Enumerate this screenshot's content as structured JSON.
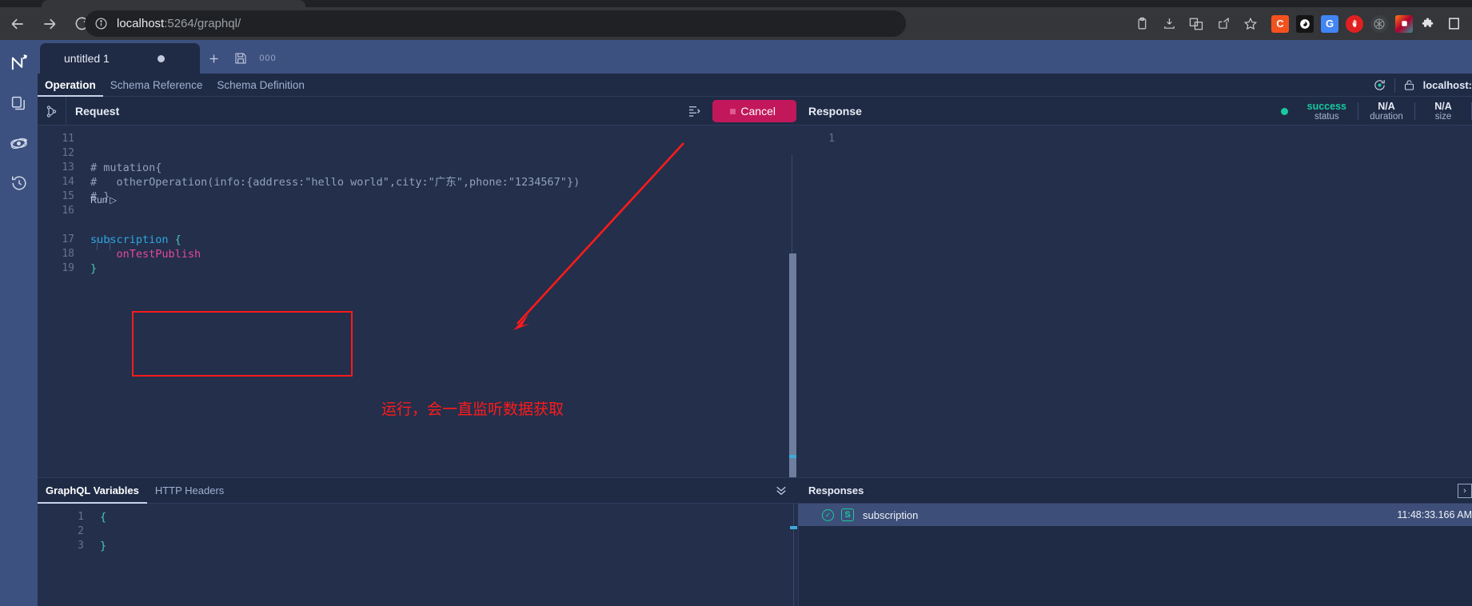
{
  "browser": {
    "nav": {
      "back": "back-arrow",
      "forward": "forward-arrow",
      "reload": "reload"
    },
    "url_host": "localhost",
    "url_rest": ":5264/graphql/",
    "omnibox_actions": [
      "clipboard-icon",
      "install-app-icon",
      "translate-icon",
      "share-icon",
      "bookmark-star-icon"
    ],
    "extensions": [
      {
        "name": "C",
        "color": "#f4511e"
      },
      {
        "name": "",
        "color": "#1b1b1b"
      },
      {
        "name": "G",
        "color": "#4285f4"
      },
      {
        "name": "",
        "color": "#e02020"
      },
      {
        "name": "",
        "color": "#5f6368"
      },
      {
        "name": "",
        "color": "#c2185b"
      },
      {
        "name": "",
        "color": "#5f6368"
      },
      {
        "name": "",
        "color": "#ffffff"
      }
    ]
  },
  "rail": {
    "items": [
      {
        "name": "app-logo",
        "label": "Altair"
      },
      {
        "name": "copy-documents-icon",
        "label": "Documents"
      },
      {
        "name": "atom-icon",
        "label": "Environments"
      },
      {
        "name": "history-clock-icon",
        "label": "History"
      }
    ]
  },
  "tabbar": {
    "document_tab": "untitled 1",
    "unsaved_dot": true,
    "add_label": "+",
    "save_label": "save-icon",
    "more_label": "000"
  },
  "section_tabs": [
    {
      "label": "Operation",
      "active": true
    },
    {
      "label": "Schema Reference",
      "active": false
    },
    {
      "label": "Schema Definition",
      "active": false
    }
  ],
  "section_right": {
    "reload_docs_icon": "refresh-docs-icon",
    "lock_icon": "unlocked-padlock-icon",
    "endpoint": "localhost:"
  },
  "request": {
    "panel_title": "Request",
    "gutter_icon": "history-branch-icon",
    "prettify_icon": "prettify-icon",
    "cancel_label": "Cancel",
    "run_lens": "Run ▷",
    "code_lines": [
      {
        "no": "11",
        "segments": []
      },
      {
        "no": "12",
        "segments": []
      },
      {
        "no": "13",
        "segments": [
          {
            "t": "# mutation{",
            "c": "c-comment"
          }
        ]
      },
      {
        "no": "14",
        "segments": [
          {
            "t": "#   otherOperation(info:{address:\"hello world\",city:\"广东\",phone:\"1234567\"})",
            "c": "c-comment"
          }
        ]
      },
      {
        "no": "15",
        "segments": [
          {
            "t": "# }",
            "c": "c-comment"
          }
        ]
      },
      {
        "no": "16",
        "segments": []
      },
      {
        "no": "17",
        "segments": [
          {
            "t": "subscription ",
            "c": "c-key"
          },
          {
            "t": "{",
            "c": "c-punc"
          }
        ]
      },
      {
        "no": "18",
        "segments": [
          {
            "t": "    onTestPublish",
            "c": "c-field"
          }
        ]
      },
      {
        "no": "19",
        "segments": [
          {
            "t": "}",
            "c": "c-punc"
          }
        ]
      }
    ],
    "annotation": "运行，会一直监听数据获取",
    "annotation_color": "#ff1a1a",
    "highlight_box_color": "#ff1a1a"
  },
  "variables": {
    "tabs": [
      {
        "label": "GraphQL Variables",
        "active": true
      },
      {
        "label": "HTTP Headers",
        "active": false
      }
    ],
    "collapse_icon": "chevron-double-down-icon",
    "code_lines": [
      {
        "no": "1",
        "text": "{"
      },
      {
        "no": "2",
        "text": ""
      },
      {
        "no": "3",
        "text": "}"
      }
    ]
  },
  "response": {
    "panel_title": "Response",
    "stats": [
      {
        "value": "success",
        "label": "status",
        "color": "#19c9a0"
      },
      {
        "value": "N/A",
        "label": "duration",
        "color": "#e7ebf5"
      },
      {
        "value": "N/A",
        "label": "size",
        "color": "#e7ebf5"
      }
    ],
    "code_lines": [
      {
        "no": "1",
        "text": ""
      }
    ]
  },
  "responses": {
    "panel_title": "Responses",
    "expand_icon": "expand-right-icon",
    "rows": [
      {
        "status_icon": "check-circle-icon",
        "kind": "S",
        "name": "subscription",
        "time": "11:48:33.166 AM"
      }
    ]
  },
  "colors": {
    "accent_pink": "#c2185b",
    "success_green": "#19c9a0",
    "panel_bg": "#1f2b45",
    "editor_bg": "#232f4b",
    "rail_bg": "#3d5180"
  }
}
